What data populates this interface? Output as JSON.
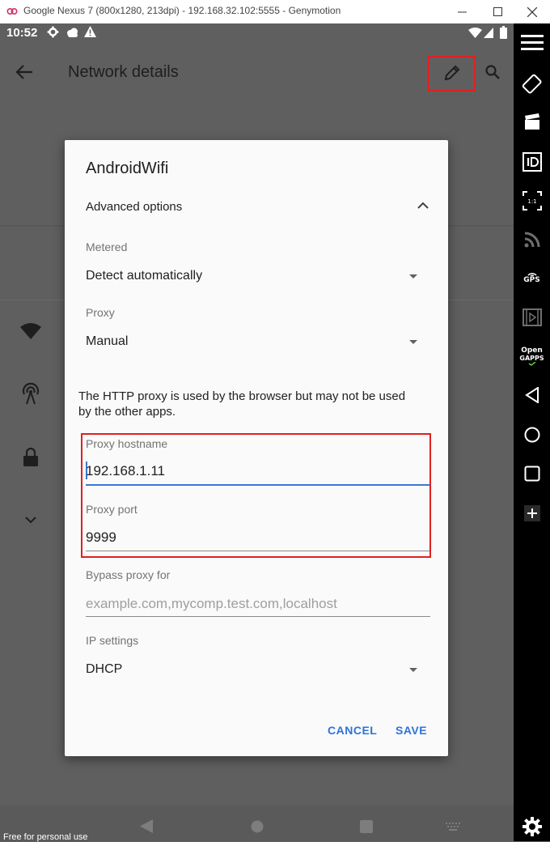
{
  "window": {
    "title": "Google Nexus 7 (800x1280, 213dpi) - 192.168.32.102:5555 - Genymotion"
  },
  "status_bar": {
    "time": "10:52"
  },
  "app_bar": {
    "title": "Network details"
  },
  "dialog": {
    "title": "AndroidWifi",
    "advanced_options_label": "Advanced options",
    "metered": {
      "label": "Metered",
      "value": "Detect automatically"
    },
    "proxy": {
      "label": "Proxy",
      "value": "Manual"
    },
    "proxy_helper": "The HTTP proxy is used by the browser but may not be used by the other apps.",
    "proxy_hostname": {
      "label": "Proxy hostname",
      "value": "192.168.1.11"
    },
    "proxy_port": {
      "label": "Proxy port",
      "value": "9999"
    },
    "bypass_proxy": {
      "label": "Bypass proxy for",
      "placeholder": "example.com,mycomp.test.com,localhost"
    },
    "ip_settings": {
      "label": "IP settings",
      "value": "DHCP"
    },
    "cancel_label": "CANCEL",
    "save_label": "SAVE"
  },
  "sidebar": {
    "scale_label": "1:1",
    "gps_label": "GPS",
    "opengapps_line1": "Open",
    "opengapps_line2": "GAPPS"
  },
  "watermark": "Free for personal use",
  "colors": {
    "accent": "#2f73d8",
    "highlight_box": "#e02020",
    "dim_background": "#5f5f5f"
  }
}
